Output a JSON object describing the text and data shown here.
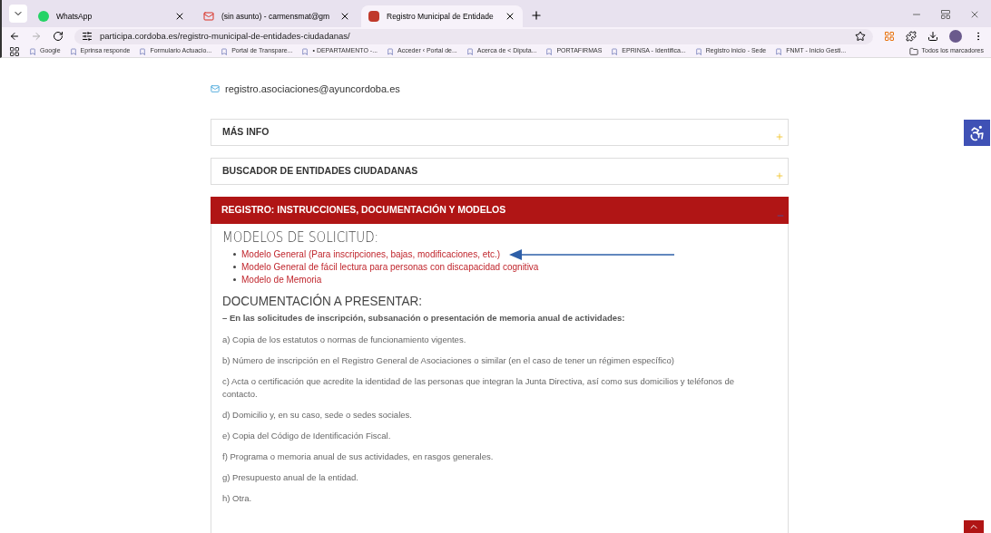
{
  "tabs": [
    {
      "title": "WhatsApp",
      "kind": "whatsapp",
      "selected": false
    },
    {
      "title": "(sin asunto) - carmensmat@gm",
      "kind": "gmail",
      "selected": false
    },
    {
      "title": "Registro Municipal de Entidade",
      "kind": "crest",
      "selected": true
    }
  ],
  "address": "participa.cordoba.es/registro-municipal-de-entidades-ciudadanas/",
  "bookmarks": [
    "Google",
    "Eprinsa responde",
    "Formulario Actuacio...",
    "Portal de Transpare...",
    "• DEPARTAMENTO -...",
    "Acceder ‹ Portal de...",
    "Acerca de < Diputa...",
    "PORTAFIRMAS",
    "EPRINSA - Identifica...",
    "Registro inicio - Sede",
    "FNMT - Inicio Gesti..."
  ],
  "all_bookmarks": "Todos los marcadores",
  "email": "registro.asociaciones@ayuncordoba.es",
  "sections": [
    {
      "title": "MÁS INFO",
      "expanded": false
    },
    {
      "title": "BUSCADOR DE ENTIDADES CIUDADANAS",
      "expanded": false
    },
    {
      "title": "REGISTRO: INSTRUCCIONES, DOCUMENTACIÓN Y MODELOS",
      "expanded": true
    }
  ],
  "models_heading": "MODELOS DE SOLICITUD:",
  "models": [
    "Modelo General (Para inscripciones, bajas, modificaciones, etc.)",
    "Modelo General de fácil lectura para personas con discapacidad cognitiva",
    "Modelo de Memoria"
  ],
  "docs_heading": "DOCUMENTACIÓN A PRESENTAR:",
  "docs_intro": "– En las solicitudes de inscripción, subsanación o presentación de memoria anual de actividades:",
  "docs": [
    "a) Copia de los estatutos o normas de funcionamiento vigentes.",
    "b) Número de inscripción en el Registro General de Asociaciones o similar (en el caso de tener un régimen específico)",
    "c) Acta o certificación que acredite la identidad de las personas que integran la Junta Directiva, así como sus domicilios y teléfonos de contacto.",
    "d) Domicilio y, en su caso, sede o sedes sociales.",
    "e) Copia del Código de Identificación Fiscal.",
    "f) Programa o memoria anual de sus actividades, en rasgos generales.",
    "g) Presupuesto anual de la entidad.",
    "h) Otra."
  ]
}
